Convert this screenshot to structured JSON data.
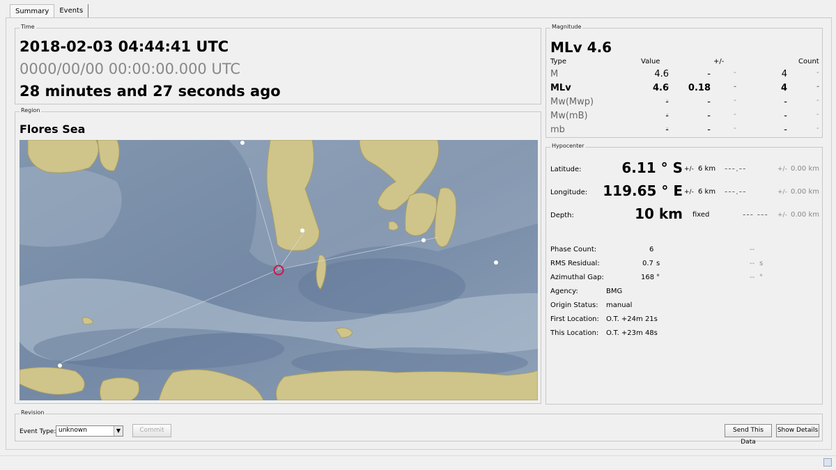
{
  "tabs": [
    {
      "label": "Summary",
      "active": true
    },
    {
      "label": "Events",
      "active": false
    }
  ],
  "time": {
    "group_title": "Time",
    "origin_time": "2018-02-03   04:44:41 UTC",
    "secondary_time": "0000/00/00   00:00:00.000 UTC",
    "elapsed": "28 minutes and 27 seconds ago"
  },
  "region": {
    "group_title": "Region",
    "name": "Flores Sea"
  },
  "magnitude": {
    "group_title": "Magnitude",
    "headline": "MLv  4.6",
    "headers": {
      "type": "Type",
      "value": "Value",
      "uncertainty": "+/-",
      "count": "Count"
    },
    "rows": [
      {
        "type": "M",
        "value": "4.6",
        "d1": "-",
        "unc": "-",
        "d2": "-",
        "count": "4",
        "d3": "-"
      },
      {
        "type": "MLv",
        "value": "4.6",
        "d1": "-",
        "unc": "0.18",
        "d2": "-",
        "count": "4",
        "d3": "-"
      },
      {
        "type": "Mw(Mwp)",
        "value": "-",
        "d1": "-",
        "unc": "-",
        "d2": "-",
        "count": "-",
        "d3": "-"
      },
      {
        "type": "Mw(mB)",
        "value": "-",
        "d1": "-",
        "unc": "-",
        "d2": "-",
        "count": "-",
        "d3": "-"
      },
      {
        "type": "mb",
        "value": "-",
        "d1": "-",
        "unc": "-",
        "d2": "-",
        "count": "-",
        "d3": "-"
      }
    ]
  },
  "hypocenter": {
    "group_title": "Hypocenter",
    "latitude": {
      "label": "Latitude:",
      "value": "6.11 ° S",
      "pm": "+/-",
      "err": "6 km",
      "ref": "---.--",
      "pm2": "+/-",
      "ref_err": "0.00 km"
    },
    "longitude": {
      "label": "Longitude:",
      "value": "119.65 ° E",
      "pm": "+/-",
      "err": "6 km",
      "ref": "---.--",
      "pm2": "+/-",
      "ref_err": "0.00 km"
    },
    "depth": {
      "label": "Depth:",
      "value": "10 km",
      "pm": "",
      "err": "fixed",
      "ref": "--- ---",
      "pm2": "+/-",
      "ref_err": "0.00 km"
    },
    "phase_count": {
      "label": "Phase Count:",
      "value": "6",
      "ref": "--"
    },
    "rms_residual": {
      "label": "RMS Residual:",
      "value": "0.7",
      "unit": "s",
      "ref": "--",
      "ref_unit": "s"
    },
    "azimuthal_gap": {
      "label": "Azimuthal Gap:",
      "value": "168",
      "unit": "°",
      "ref": "--",
      "ref_unit": "°"
    },
    "agency": {
      "label": "Agency:",
      "value": "BMG"
    },
    "origin_status": {
      "label": "Origin Status:",
      "value": "manual"
    },
    "first_location": {
      "label": "First Location:",
      "value": "O.T. +24m 21s"
    },
    "this_location": {
      "label": "This Location:",
      "value": "O.T. +23m 48s"
    }
  },
  "revision": {
    "group_title": "Revision",
    "event_type_label": "Event Type:",
    "event_type_value": "unknown",
    "commit_label": "Commit",
    "send_label": "Send This Data",
    "details_label": "Show Details"
  },
  "colors": {
    "sea": "#7b90aa",
    "land": "#cfc48a",
    "epicenter": "#cc1744"
  }
}
